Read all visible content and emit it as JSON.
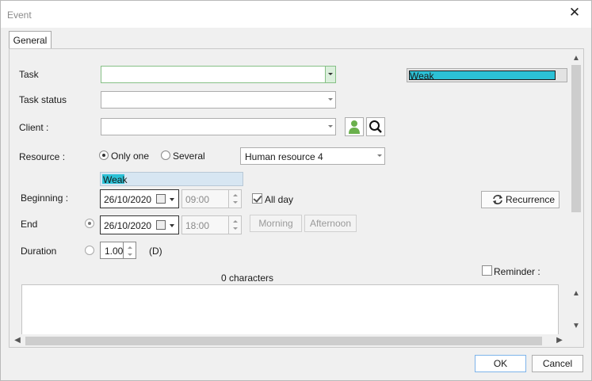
{
  "window": {
    "title": "Event",
    "close_glyph": "✕"
  },
  "tabs": [
    {
      "label": "General"
    }
  ],
  "form": {
    "task_label": "Task",
    "task_value": "",
    "task_status_label": "Task status",
    "task_status_value": "",
    "client_label": "Client :",
    "client_value": "",
    "resource_label": "Resource :",
    "resource_option_only_one": "Only one",
    "resource_option_several": "Several",
    "resource_value": "Human resource 4",
    "priority_right": "Weak",
    "priority_resource": "Weak",
    "beginning_label": "Beginning :",
    "beginning_date": "26/10/2020",
    "beginning_time": "09:00",
    "all_day_label": "All day",
    "recurrence_label": "Recurrence",
    "end_label": "End",
    "end_date": "26/10/2020",
    "end_time": "18:00",
    "morning_label": "Morning",
    "afternoon_label": "Afternoon",
    "duration_label": "Duration",
    "duration_value": "1.00",
    "duration_unit": "(D)",
    "char_count": "0 characters",
    "reminder_label": "Reminder :"
  },
  "footer": {
    "ok_label": "OK",
    "cancel_label": "Cancel"
  },
  "colors": {
    "weak_fill": "#2cc1d6",
    "client_icon": "#6ab04c"
  }
}
